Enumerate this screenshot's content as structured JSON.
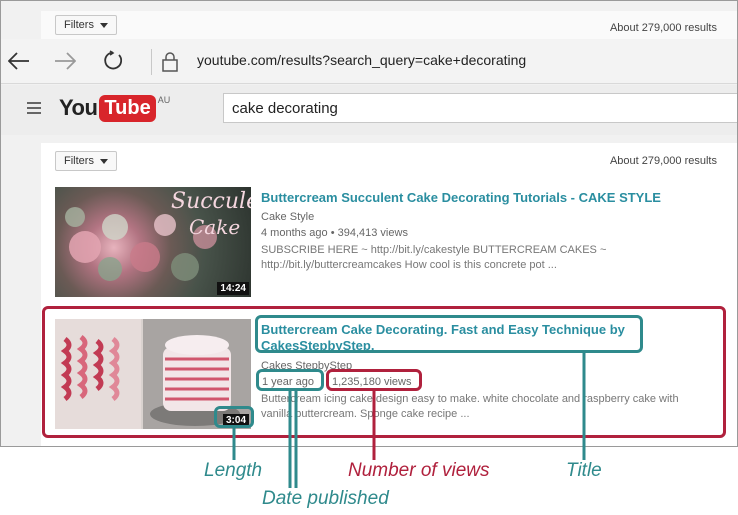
{
  "background_bar": {
    "filters_label": "Filters",
    "results_count": "About 279,000 results"
  },
  "browser": {
    "back_icon": "back-arrow-icon",
    "forward_icon": "forward-arrow-icon",
    "refresh_icon": "refresh-icon",
    "lock_icon": "lock-icon",
    "address": "youtube.com/results?search_query=cake+decorating"
  },
  "youtube": {
    "menu_icon": "hamburger-icon",
    "logo_you": "You",
    "logo_tube": "Tube",
    "logo_region": "AU",
    "search_query": "cake decorating"
  },
  "results_panel": {
    "filters_label": "Filters",
    "results_count": "About 279,000 results",
    "results": [
      {
        "title": "Buttercream Succulent Cake Decorating Tutorials - CAKE STYLE",
        "channel": "Cake Style",
        "meta": "4 months ago • 394,413 views",
        "description_line1": "SUBSCRIBE HERE ~ http://bit.ly/cakestyle BUTTERCREAM CAKES ~",
        "description_line2": "http://bit.ly/buttercreamcakes How cool is this concrete pot ...",
        "duration": "14:24",
        "thumb_text_1": "Succulent",
        "thumb_text_2": "Cake"
      },
      {
        "title_line1": "Buttercream Cake Decorating. Fast and Easy Technique by",
        "title_line2": "CakesStepbyStep.",
        "channel": "Cakes StepbyStep",
        "date": "1 year ago",
        "views": "1,235,180 views",
        "description_line1": "Buttercream icing cake design easy to make. white chocolate and raspberry cake with",
        "description_line2": "vanilla buttercream. Sponge cake recipe ...",
        "duration": "3:04"
      }
    ]
  },
  "annotations": {
    "length": "Length",
    "date_published": "Date published",
    "number_of_views": "Number of views",
    "title": "Title"
  },
  "colors": {
    "teal": "#2f8a8c",
    "crimson": "#b0213d",
    "link": "#2a8ea0",
    "youtube_red": "#d8252b"
  }
}
